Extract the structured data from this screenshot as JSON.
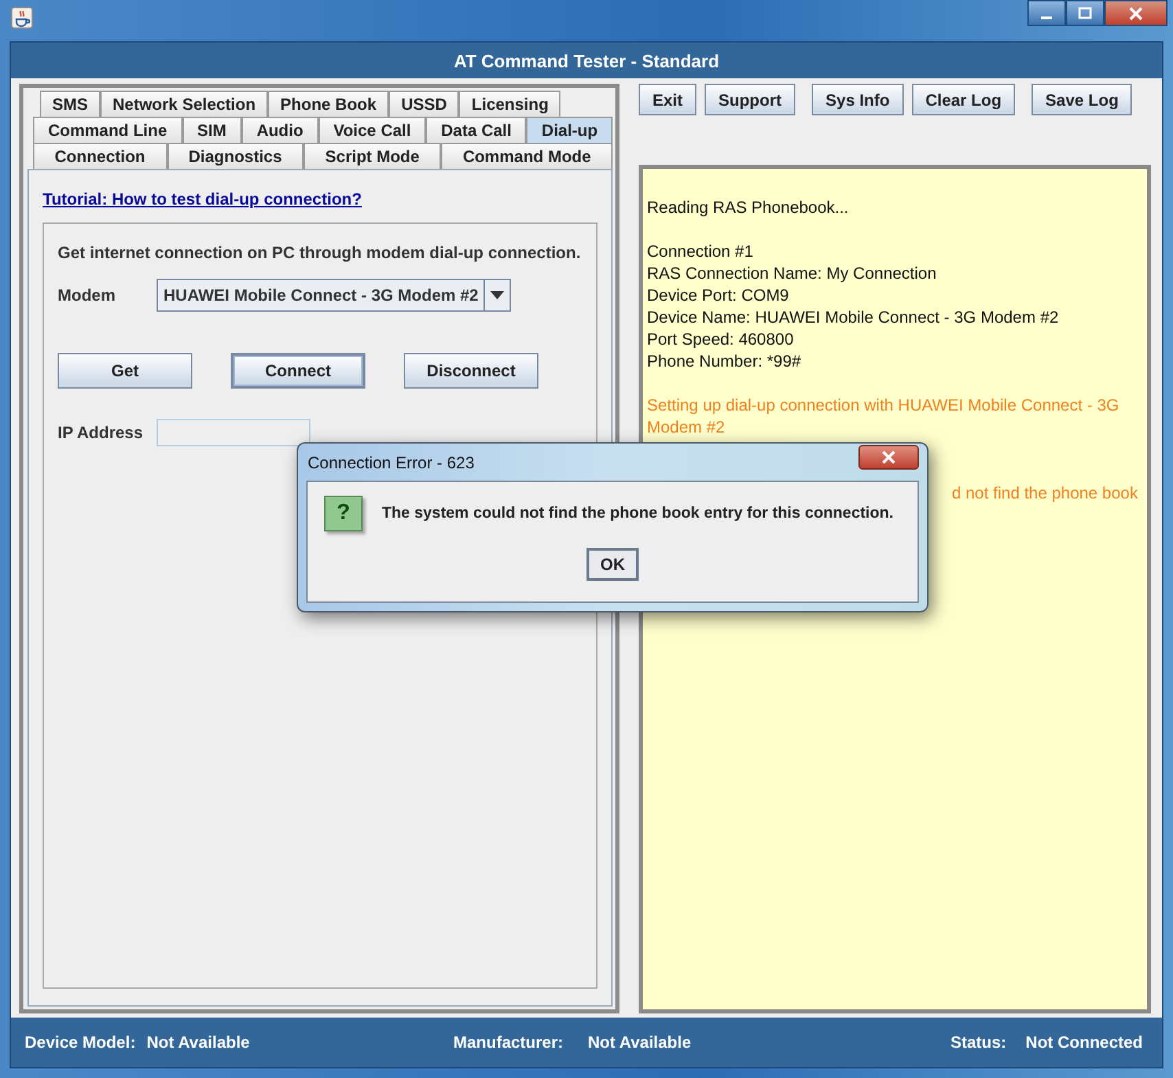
{
  "window": {
    "title": "AT Command Tester - Standard"
  },
  "tab_rows": [
    [
      {
        "label": "SMS",
        "selected": false
      },
      {
        "label": "Network Selection",
        "selected": false
      },
      {
        "label": "Phone Book",
        "selected": false
      },
      {
        "label": "USSD",
        "selected": false
      },
      {
        "label": "Licensing",
        "selected": false
      }
    ],
    [
      {
        "label": "Command Line",
        "selected": false
      },
      {
        "label": "SIM",
        "selected": false
      },
      {
        "label": "Audio",
        "selected": false
      },
      {
        "label": "Voice Call",
        "selected": false
      },
      {
        "label": "Data Call",
        "selected": false
      },
      {
        "label": "Dial-up",
        "selected": true
      }
    ],
    [
      {
        "label": "Connection",
        "selected": false
      },
      {
        "label": "Diagnostics",
        "selected": false
      },
      {
        "label": "Script Mode",
        "selected": false
      },
      {
        "label": "Command Mode",
        "selected": false
      }
    ]
  ],
  "tutorial_link": "Tutorial: How to test dial-up connection?",
  "dialup": {
    "description": "Get internet connection on PC through modem dial-up connection.",
    "modem_label": "Modem",
    "modem_value": "HUAWEI Mobile Connect - 3G Modem #2",
    "buttons": [
      {
        "label": "Get",
        "focused": false
      },
      {
        "label": "Connect",
        "focused": true
      },
      {
        "label": "Disconnect",
        "focused": false
      }
    ],
    "ip_label": "IP Address"
  },
  "toolbar": [
    "Exit",
    "Support",
    "Sys Info",
    "Clear Log",
    "Save Log"
  ],
  "log": [
    {
      "kind": "info",
      "lines": [
        "Reading RAS Phonebook..."
      ]
    },
    {
      "kind": "info",
      "lines": [
        "Connection #1",
        "RAS Connection Name: My Connection",
        "Device Port: COM9",
        "Device Name: HUAWEI Mobile Connect - 3G Modem #2",
        "Port Speed: 460800",
        "Phone Number: *99#"
      ]
    },
    {
      "kind": "action",
      "lines": [
        "Setting up dial-up connection with HUAWEI Mobile Connect - 3G Modem #2"
      ]
    },
    {
      "kind": "covered",
      "lines": [
        "d not find the phone book"
      ]
    }
  ],
  "status_bar": [
    {
      "label": "Device Model:",
      "value": "Not Available"
    },
    {
      "label": "Manufacturer:",
      "value": "Not Available"
    },
    {
      "label": "Status:",
      "value": "Not Connected"
    }
  ],
  "dialog": {
    "title": "Connection Error - 623",
    "message": "The system could not find the phone book entry for this connection.",
    "icon": "?",
    "button": "OK"
  }
}
